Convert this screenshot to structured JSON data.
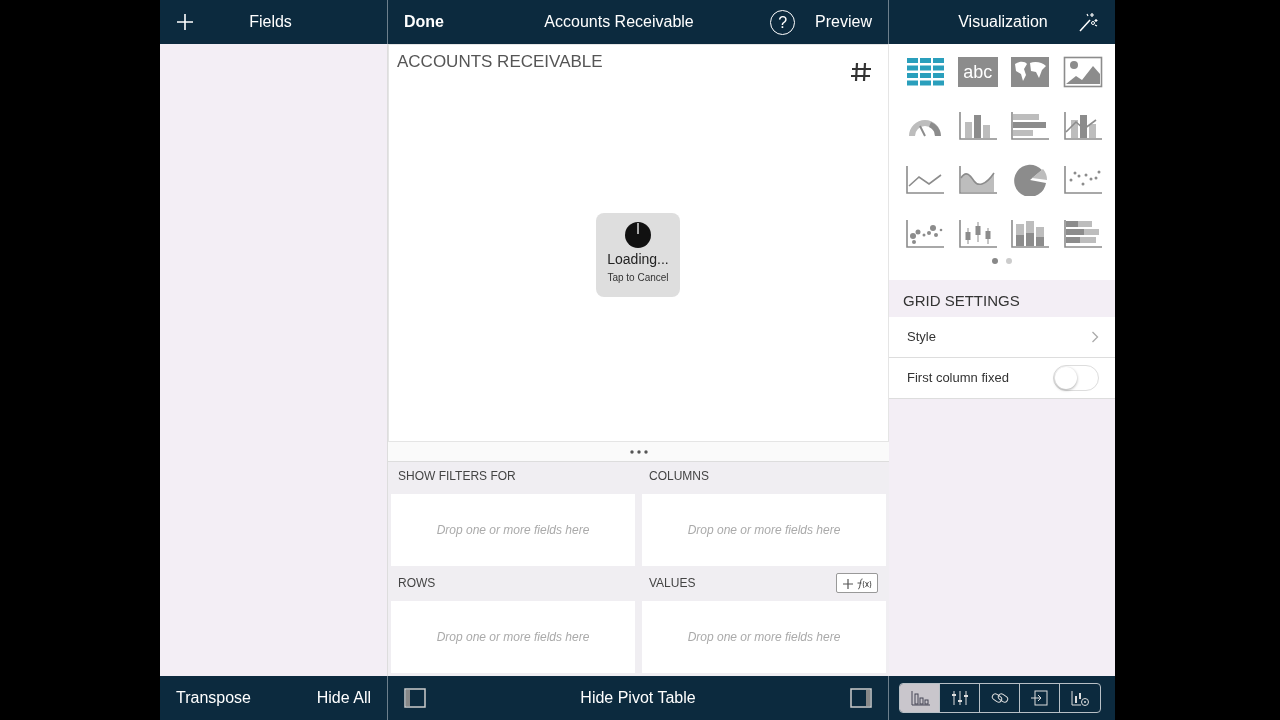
{
  "top_bar": {
    "fields_title": "Fields",
    "done": "Done",
    "title": "Accounts Receivable",
    "help": "?",
    "preview": "Preview",
    "visualization_title": "Visualization"
  },
  "widget": {
    "title": "ACCOUNTS RECEIVABLE",
    "loading": "Loading...",
    "cancel_hint": "Tap to Cancel"
  },
  "pivot_zones": [
    {
      "label": "SHOW FILTERS FOR",
      "placeholder": "Drop one or more fields here",
      "formula_button": false
    },
    {
      "label": "COLUMNS",
      "placeholder": "Drop one or more fields here",
      "formula_button": false
    },
    {
      "label": "ROWS",
      "placeholder": "Drop one or more fields here",
      "formula_button": false
    },
    {
      "label": "VALUES",
      "placeholder": "Drop one or more fields here",
      "formula_button": true
    }
  ],
  "visualizations": [
    {
      "kind": "table",
      "selected": true
    },
    {
      "kind": "text",
      "label": "abc",
      "selected": false
    },
    {
      "kind": "map",
      "selected": false
    },
    {
      "kind": "image",
      "selected": false
    },
    {
      "kind": "gauge",
      "selected": false
    },
    {
      "kind": "column",
      "selected": false
    },
    {
      "kind": "bar",
      "selected": false
    },
    {
      "kind": "combo",
      "selected": false
    },
    {
      "kind": "line",
      "selected": false
    },
    {
      "kind": "area",
      "selected": false
    },
    {
      "kind": "pie",
      "selected": false
    },
    {
      "kind": "scatter",
      "selected": false
    },
    {
      "kind": "bubble",
      "selected": false
    },
    {
      "kind": "candlestick",
      "selected": false
    },
    {
      "kind": "stacked-column",
      "selected": false
    },
    {
      "kind": "stacked-bar",
      "selected": false
    }
  ],
  "pages": [
    {
      "selected": true
    },
    {
      "selected": false
    }
  ],
  "grid_settings": {
    "title": "GRID SETTINGS",
    "style": "Style",
    "first_column_fixed": {
      "label": "First column fixed",
      "on": false
    }
  },
  "bottom_bar": {
    "transpose": "Transpose",
    "hide_all": "Hide All",
    "hide_pivot": "Hide Pivot Table"
  },
  "toolbar": [
    {
      "kind": "chart",
      "selected": true
    },
    {
      "kind": "sliders",
      "selected": false
    },
    {
      "kind": "link",
      "selected": false
    },
    {
      "kind": "export",
      "selected": false
    },
    {
      "kind": "chart-settings",
      "selected": false
    }
  ]
}
